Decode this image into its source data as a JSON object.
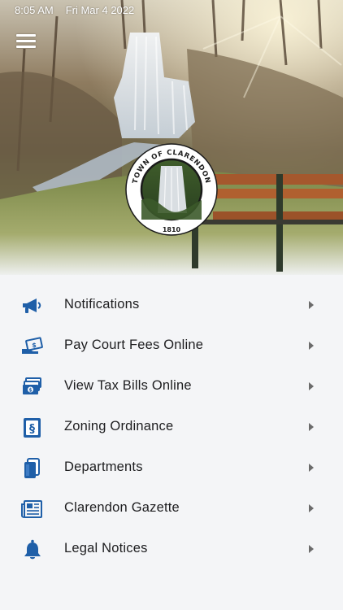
{
  "status_bar": {
    "time": "8:05 AM",
    "date": "Fri Mar 4 2022"
  },
  "header": {
    "menu_icon": "hamburger-menu-icon",
    "seal": {
      "top_text": "TOWN OF CLARENDON",
      "year": "1810"
    }
  },
  "colors": {
    "accent": "#1f5fa8",
    "label": "#1d1d1f",
    "chevron": "#6b6b6b",
    "background": "#f4f5f7"
  },
  "menu": {
    "items": [
      {
        "label": "Notifications",
        "icon": "megaphone-icon"
      },
      {
        "label": "Pay Court Fees Online",
        "icon": "hand-payment-icon"
      },
      {
        "label": "View Tax Bills Online",
        "icon": "money-bills-icon"
      },
      {
        "label": "Zoning Ordinance",
        "icon": "section-document-icon"
      },
      {
        "label": "Departments",
        "icon": "books-icon"
      },
      {
        "label": "Clarendon Gazette",
        "icon": "newspaper-icon"
      },
      {
        "label": "Legal Notices",
        "icon": "bell-icon"
      }
    ]
  }
}
